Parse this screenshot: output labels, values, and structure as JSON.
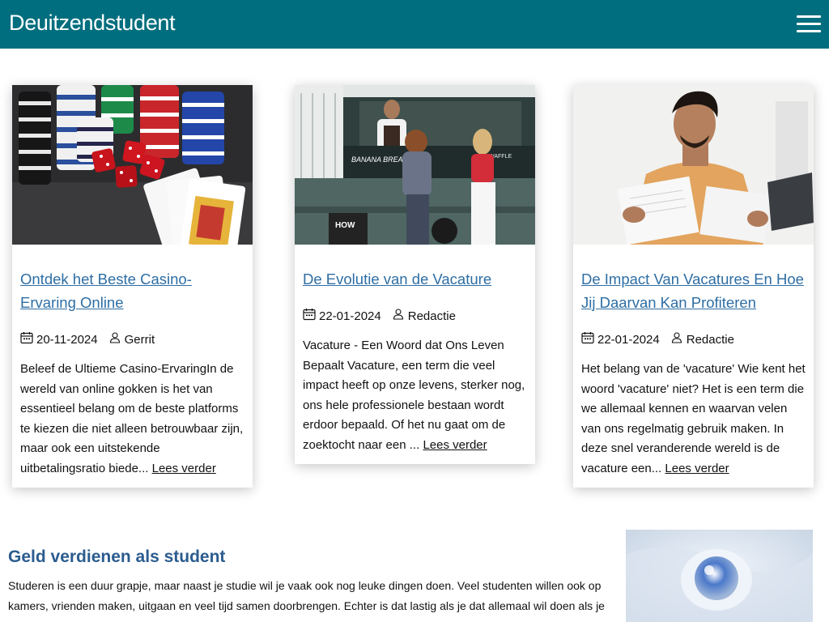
{
  "header": {
    "site_title": "Deuitzendstudent",
    "menu_icon": "hamburger-icon",
    "bg_color": "#006e7e"
  },
  "posts": [
    {
      "title": "Ontdek het Beste Casino-Ervaring Online",
      "date": "20-11-2024",
      "author": "Gerrit",
      "excerpt": "Beleef de Ultieme Casino-ErvaringIn de wereld van online gokken is het van essentieel belang om de beste platforms te kiezen die niet alleen betrouwbaar zijn, maar ook een uitstekende uitbetalingsratio biede... ",
      "read_more": "Lees verder",
      "image": "casino-chips-dice-cards-photo"
    },
    {
      "title": "De Evolutie van de Vacature",
      "date": "22-01-2024",
      "author": "Redactie",
      "excerpt": "Vacature - Een Woord dat Ons Leven Bepaalt Vacature, een term die veel impact heeft op onze levens, sterker nog, ons hele professionele bestaan wordt erdoor bepaald. Of het nu gaat om de zoektocht naar een ... ",
      "read_more": "Lees verder",
      "image": "food-truck-photo"
    },
    {
      "title": "De Impact Van Vacatures En Hoe Jij Daarvan Kan Profiteren",
      "date": "22-01-2024",
      "author": "Redactie",
      "excerpt": "Het belang van de 'vacature' Wie kent het woord 'vacature' niet? Het is een term die we allemaal kennen en waarvan velen van ons regelmatig gebruik maken. In deze snel veranderende wereld is de vacature een... ",
      "read_more": "Lees verder",
      "image": "man-reading-papers-photo"
    }
  ],
  "meta_icons": {
    "date": "calendar-icon",
    "author": "user-icon"
  },
  "intro": {
    "heading": "Geld verdienen als student",
    "text": "Studeren is een duur grapje, maar naast je studie wil je vaak ook nog leuke dingen doen. Veel studenten willen ook op kamers, vrienden maken, uitgaan en veel tijd samen doorbrengen. Echter is dat lastig als je dat allemaal wil doen als je geen inkomen hebt. Daarom nemen veel studenten een baantje, zodat ze toch kunnen genieten van hun studententijd."
  },
  "side_image": "crystal-ball-photo",
  "colors": {
    "link_blue": "#2e6ea4",
    "heading_blue": "#2b5c8f"
  }
}
